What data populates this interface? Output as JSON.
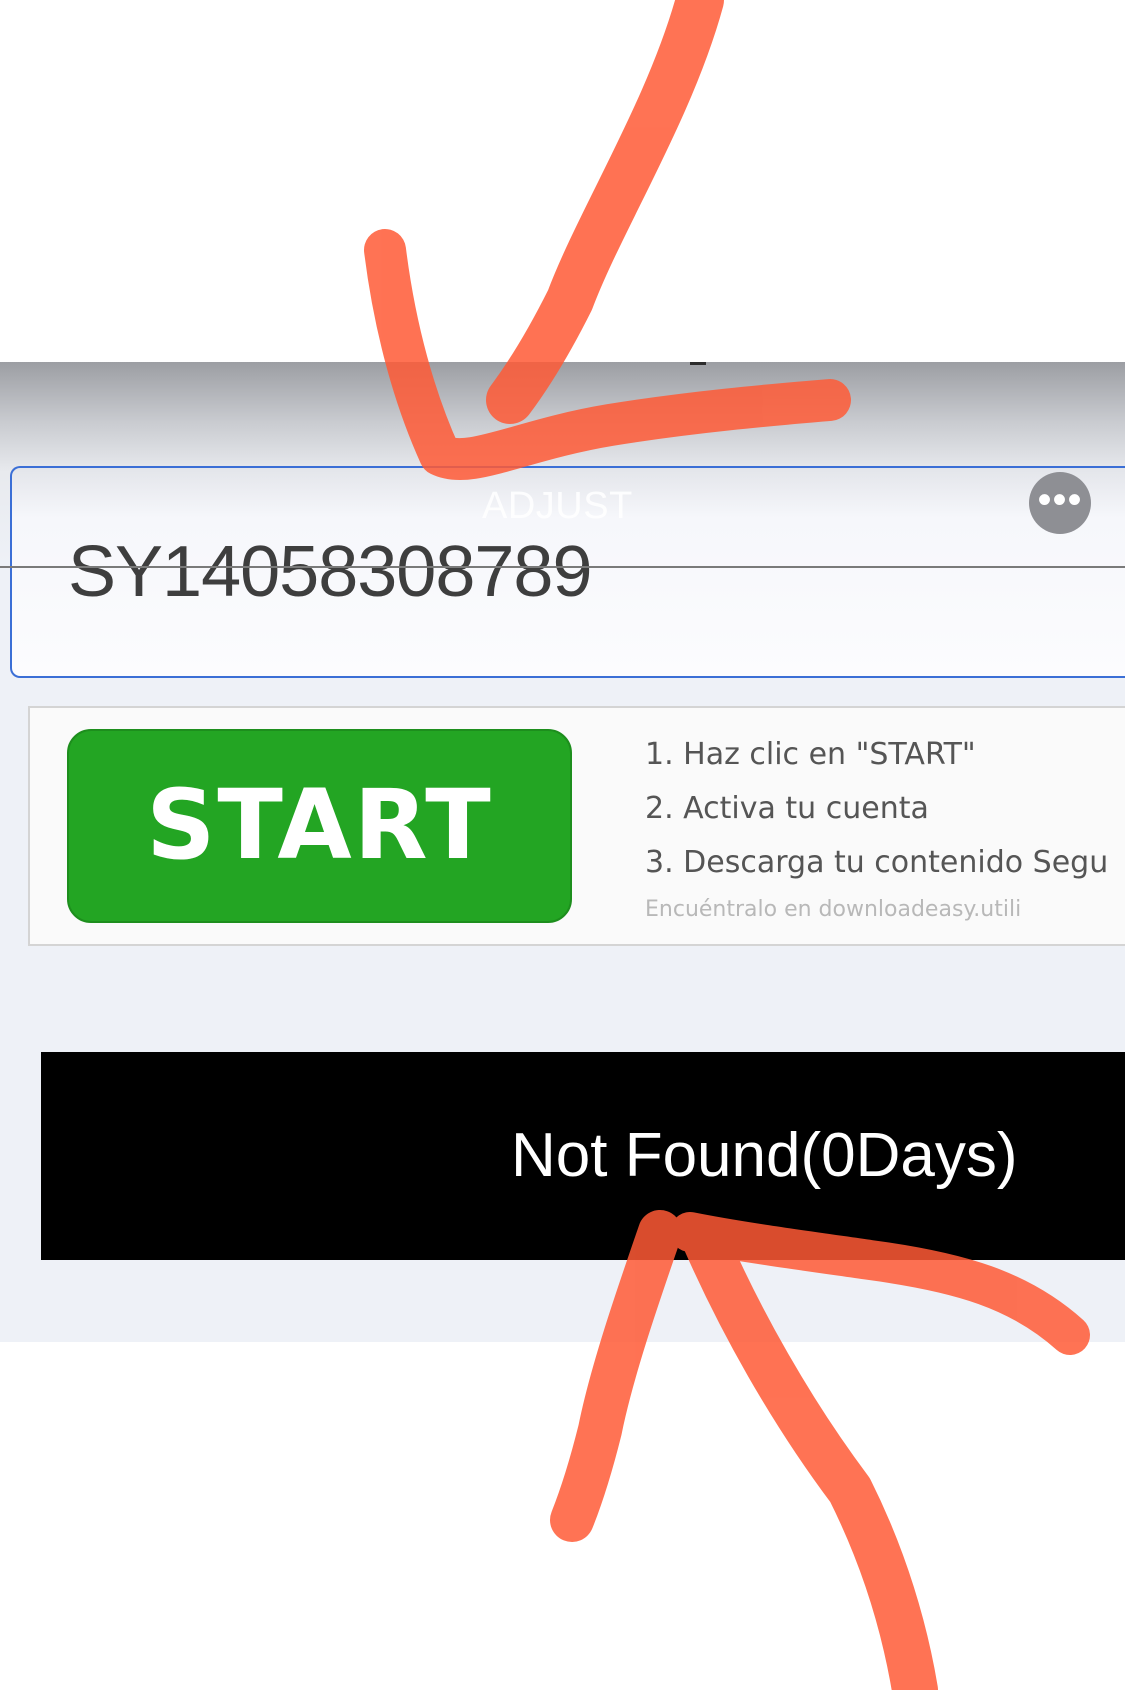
{
  "input": {
    "value": "SY14058308789",
    "overlay_label": "ADJUST"
  },
  "more_button": {
    "glyph": "•••"
  },
  "start_button": {
    "label": "START",
    "color": "#23a523"
  },
  "steps": [
    "1. Haz clic en \"START\"",
    "2. Activa tu cuenta",
    "3. Descarga tu contenido Segu"
  ],
  "steps_note": "Encuéntralo en downloadeasy.utili",
  "result": {
    "text": "Not Found(0Days)"
  },
  "annotation_color": "#ff5a36",
  "accent_color": "#3b6fd6"
}
